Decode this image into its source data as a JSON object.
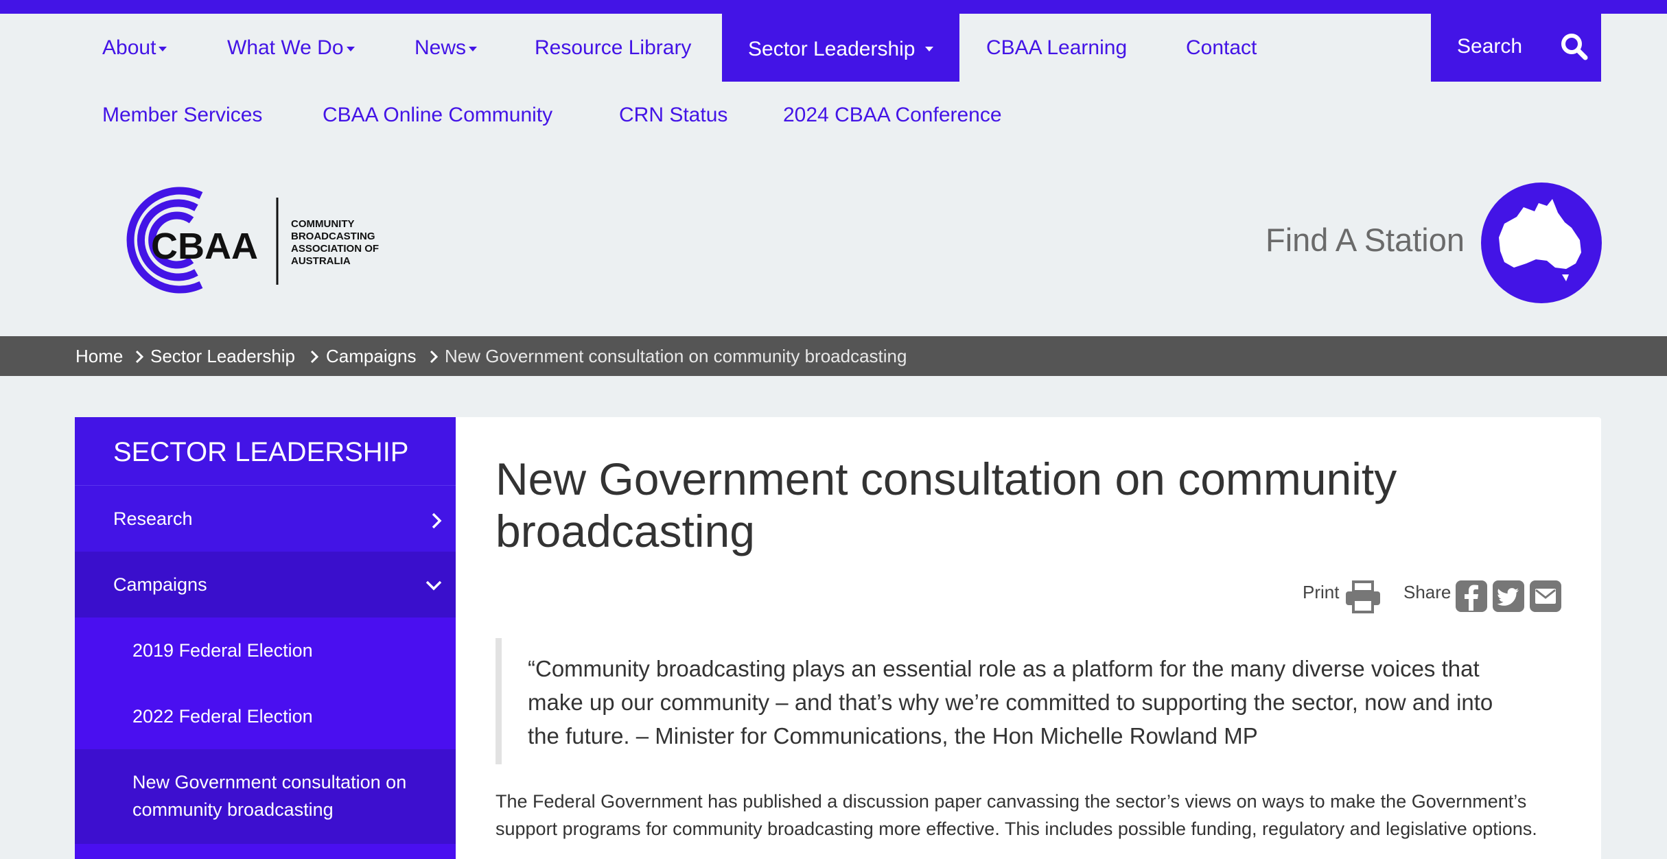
{
  "nav": {
    "row1": [
      {
        "label": "About",
        "dropdown": true
      },
      {
        "label": "What We Do",
        "dropdown": true
      },
      {
        "label": "News",
        "dropdown": true
      },
      {
        "label": "Resource Library",
        "dropdown": false
      },
      {
        "label": "Sector Leadership",
        "dropdown": true,
        "active": true
      },
      {
        "label": "CBAA Learning",
        "dropdown": false
      },
      {
        "label": "Contact",
        "dropdown": false
      }
    ],
    "row2": [
      {
        "label": "Member Services"
      },
      {
        "label": "CBAA Online Community"
      },
      {
        "label": "CRN Status"
      },
      {
        "label": "2024 CBAA Conference"
      }
    ],
    "search_label": "Search"
  },
  "logo": {
    "wordmark": "CBAA",
    "lines": [
      "COMMUNITY",
      "BROADCASTING",
      "ASSOCIATION OF",
      "AUSTRALIA"
    ]
  },
  "find_station": "Find A Station",
  "breadcrumb": [
    "Home",
    "Sector Leadership",
    "Campaigns",
    "New Government consultation on community broadcasting"
  ],
  "sidebar": {
    "title": "SECTOR LEADERSHIP",
    "items": [
      {
        "label": "Research"
      },
      {
        "label": "Campaigns"
      },
      {
        "label": "2019 Federal Election"
      },
      {
        "label": "2022 Federal Election"
      },
      {
        "label": "New Government consultation on community broadcasting"
      }
    ]
  },
  "article": {
    "title": "New Government consultation on community broadcasting",
    "print_label": "Print",
    "share_label": "Share",
    "quote": "“Community broadcasting plays an essential role as a platform for the many diverse voices that make up our community – and that’s why we’re committed to supporting the sector, now and into the future. – Minister for Communications, the Hon Michelle Rowland MP",
    "paragraph": "The Federal Government has published a discussion paper canvassing the sector’s views on ways to make the Government’s support programs for community broadcasting more effective. This includes possible funding, regulatory and legislative options."
  },
  "colors": {
    "brand": "#4314e6",
    "brand_dark": "#3d0fcf",
    "page_bg": "#ecf0f2",
    "breadcrumb_bg": "#555555"
  }
}
